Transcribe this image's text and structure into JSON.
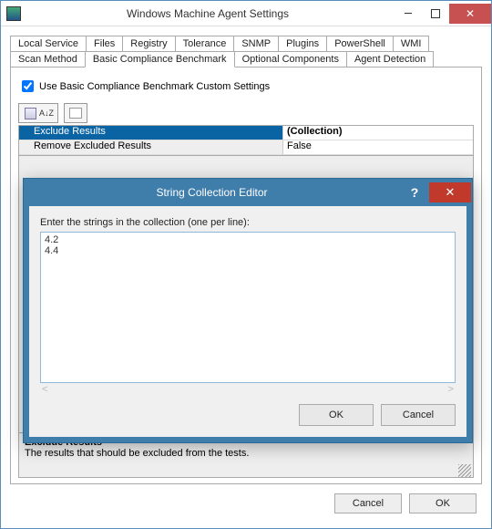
{
  "window": {
    "title": "Windows Machine Agent Settings"
  },
  "tabs": {
    "row1": [
      "Local Service",
      "Files",
      "Registry",
      "Tolerance",
      "SNMP",
      "Plugins",
      "PowerShell",
      "WMI"
    ],
    "row2": [
      "Scan Method",
      "Basic Compliance Benchmark",
      "Optional Components",
      "Agent Detection"
    ],
    "active": "Basic Compliance Benchmark"
  },
  "checkbox": {
    "label": "Use Basic Compliance Benchmark Custom Settings",
    "checked": true
  },
  "toolbar": {
    "sort_label": "A↓Z"
  },
  "props": [
    {
      "name": "Exclude Results",
      "value": "(Collection)",
      "selected": true
    },
    {
      "name": "Remove Excluded Results",
      "value": "False",
      "selected": false
    }
  ],
  "desc": {
    "heading": "Exclude Results",
    "text": "The results that should be excluded from the tests."
  },
  "footer": {
    "cancel": "Cancel",
    "ok": "OK"
  },
  "modal": {
    "title": "String Collection Editor",
    "label": "Enter the strings in the collection (one per line):",
    "text": "4.2\n4.4",
    "ok": "OK",
    "cancel": "Cancel"
  }
}
